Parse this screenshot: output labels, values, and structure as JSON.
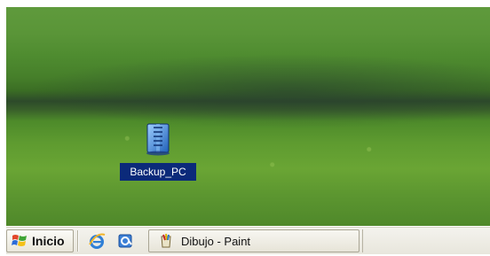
{
  "desktop": {
    "icons": [
      {
        "label": "Backup_PC",
        "icon": "backup-archive-icon"
      }
    ]
  },
  "taskbar": {
    "start_label": "Inicio",
    "quick_launch": [
      "internet-explorer-icon",
      "outlook-express-icon"
    ],
    "tasks": [
      {
        "label": "Dibujo - Paint",
        "icon": "paint-icon"
      }
    ]
  },
  "colors": {
    "selection": "#0b2a7a",
    "taskbar_bg": "#ece9d8"
  }
}
